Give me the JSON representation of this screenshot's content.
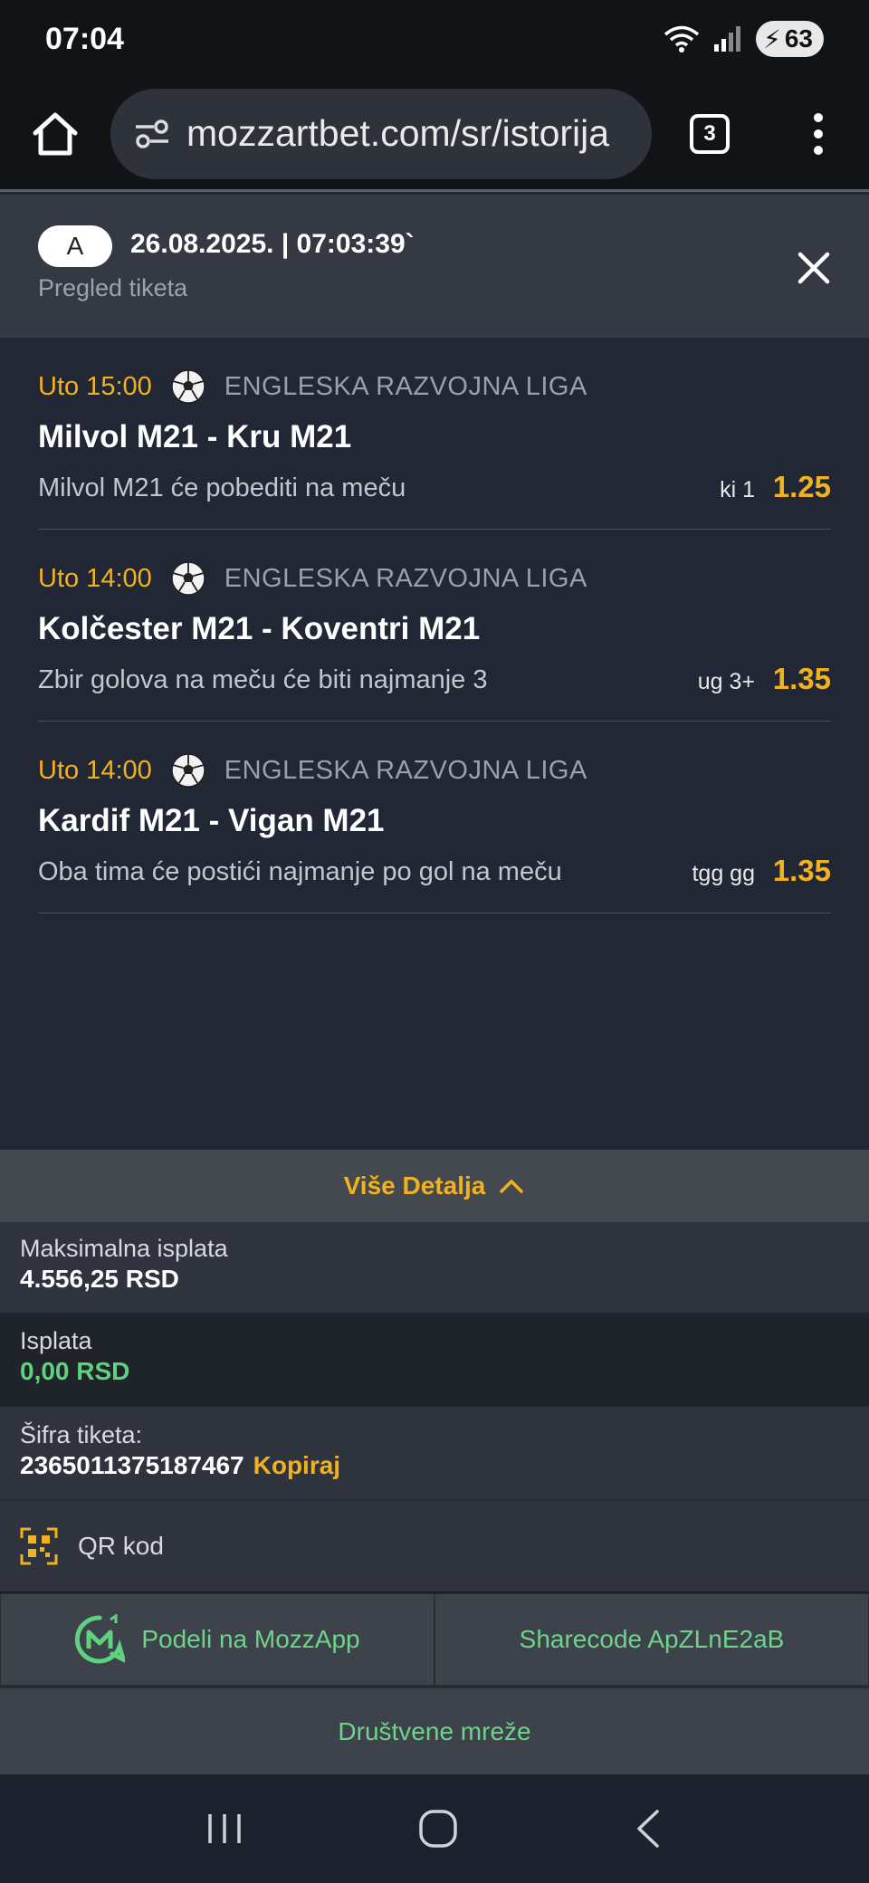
{
  "status_bar": {
    "time": "07:04",
    "battery": "63"
  },
  "browser": {
    "url": "mozzartbet.com/sr/istorija",
    "tab_count": "3"
  },
  "ticket": {
    "badge": "A",
    "datetime": "26.08.2025. | 07:03:39`",
    "subtitle": "Pregled tiketa"
  },
  "matches": [
    {
      "time": "Uto 15:00",
      "league": "ENGLESKA RAZVOJNA LIGA",
      "teams": "Milvol M21 - Kru M21",
      "pick": "Milvol M21 će pobediti na meču",
      "code": "ki 1",
      "odd": "1.25"
    },
    {
      "time": "Uto 14:00",
      "league": "ENGLESKA RAZVOJNA LIGA",
      "teams": "Kolčester M21 - Koventri M21",
      "pick": "Zbir golova na meču će biti najmanje 3",
      "code": "ug 3+",
      "odd": "1.35"
    },
    {
      "time": "Uto 14:00",
      "league": "ENGLESKA RAZVOJNA LIGA",
      "teams": "Kardif M21 - Vigan M21",
      "pick": "Oba tima će postići najmanje po gol na meču",
      "code": "tgg gg",
      "odd": "1.35"
    }
  ],
  "details": {
    "more_label": "Više Detalja",
    "max_payout_label": "Maksimalna isplata",
    "max_payout_value": "4.556,25 RSD",
    "payout_label": "Isplata",
    "payout_value": "0,00 RSD",
    "ticket_code_label": "Šifra tiketa:",
    "ticket_code_value": "2365011375187467",
    "copy_label": "Kopiraj",
    "qr_label": "QR kod"
  },
  "share": {
    "mozzapp_label": "Podeli na MozzApp",
    "sharecode_label": "Sharecode ApZLnE2aB",
    "social_label": "Društvene mreže"
  },
  "colors": {
    "accent": "#f2b21f",
    "green": "#5fd27d",
    "background": "#212734"
  },
  "icons": [
    "wifi-icon",
    "signal-icon",
    "home-icon",
    "site-settings-icon",
    "close-icon",
    "soccer-ball-icon",
    "chevron-up-icon",
    "qr-code-icon",
    "mozzapp-logo-icon",
    "recents-icon",
    "home-nav-icon",
    "back-icon"
  ]
}
